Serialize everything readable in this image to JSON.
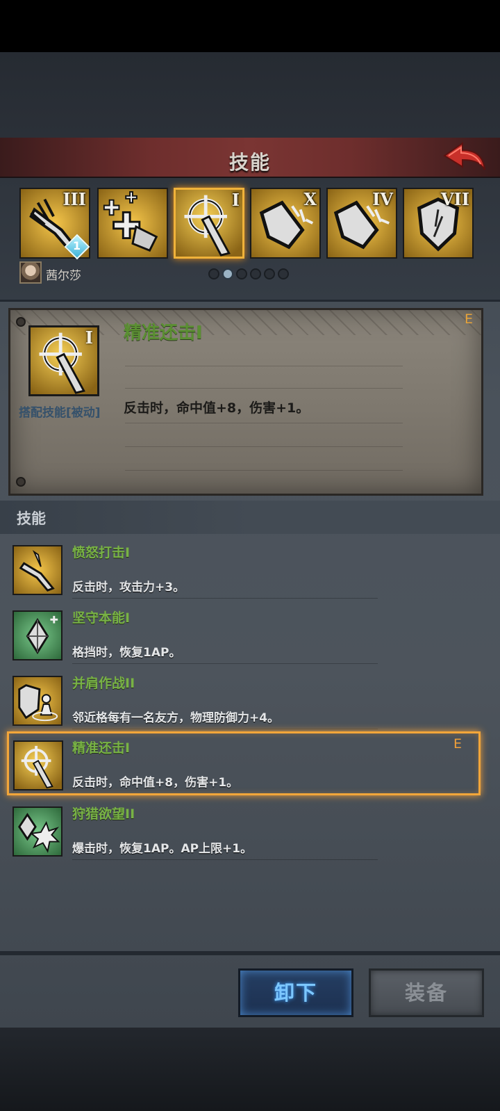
{
  "header": {
    "title": "技能"
  },
  "skill_tiles": [
    {
      "numeral": "III",
      "icon": "claw-sword-icon",
      "badge": "1"
    },
    {
      "numeral": "",
      "icon": "heal-plus-icon"
    },
    {
      "numeral": "I",
      "icon": "crosshair-sword-icon",
      "selected": true
    },
    {
      "numeral": "X",
      "icon": "shield-burst-icon"
    },
    {
      "numeral": "IV",
      "icon": "shield-burst-icon"
    },
    {
      "numeral": "VII",
      "icon": "shield-icon"
    }
  ],
  "character": {
    "name": "茜尔莎"
  },
  "pagination": {
    "pages": 6,
    "current": 2
  },
  "detail": {
    "numeral": "I",
    "type": "搭配技能[被动]",
    "name": "精准还击I",
    "desc": "反击时，命中值+8，伤害+1。",
    "equipped_mark": "E"
  },
  "list": {
    "title": "技能",
    "items": [
      {
        "name": "愤怒打击I",
        "desc": "反击时，攻击力+3。",
        "icon": "rage-strike-icon"
      },
      {
        "name": "坚守本能I",
        "desc": "格挡时，恢复1AP。",
        "icon": "crystal-icon"
      },
      {
        "name": "并肩作战II",
        "desc": "邻近格每有一名友方，物理防御力+4。",
        "icon": "shield-ally-icon"
      },
      {
        "name": "精准还击I",
        "desc": "反击时，命中值+8，伤害+1。",
        "icon": "crosshair-sword-icon",
        "mark": "E"
      },
      {
        "name": "狩猎欲望II",
        "desc": "爆击时，恢复1AP。AP上限+1。",
        "icon": "crystal-burst-icon"
      }
    ]
  },
  "buttons": {
    "unequip": "卸下",
    "equip": "装备"
  },
  "colors": {
    "accent": "#f0a03a",
    "skill_name": "#78b245",
    "button_blue": "#7cc7ff"
  }
}
